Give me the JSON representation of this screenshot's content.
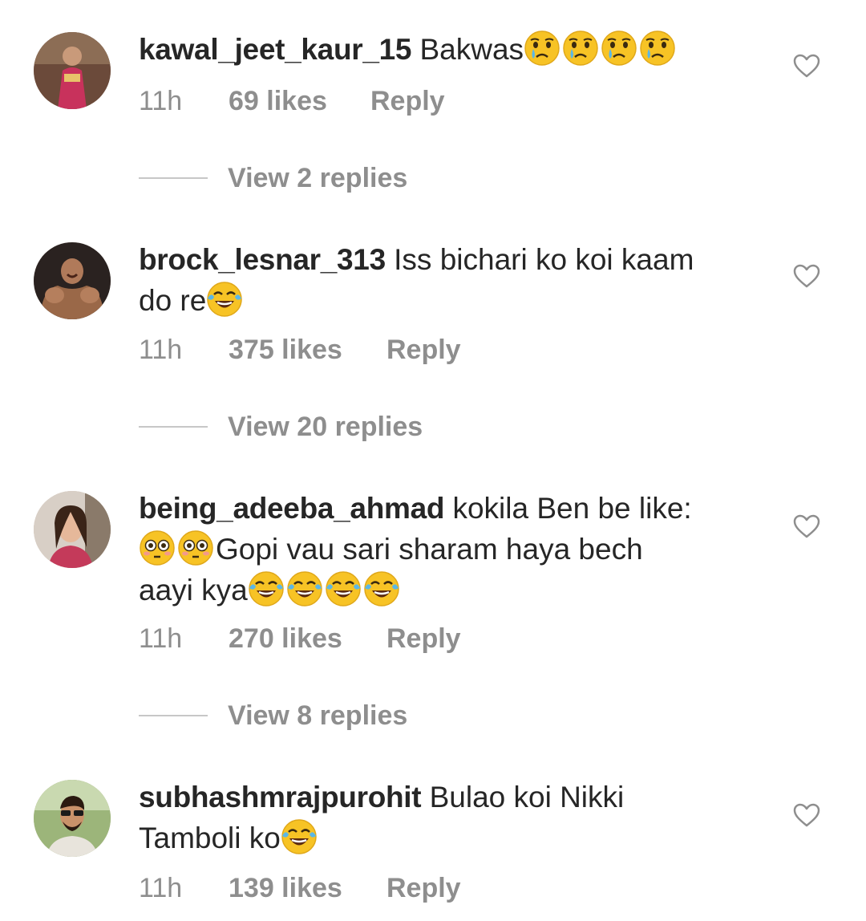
{
  "comments": [
    {
      "username": "kawal_jeet_kaur_15",
      "text_lines": [
        "Bakwas"
      ],
      "emoji_icons": [
        "crying-face",
        "crying-face",
        "crying-face",
        "crying-face"
      ],
      "time": "11h",
      "likes": "69 likes",
      "reply": "Reply",
      "view_replies": "View 2 replies",
      "avatar_icon": "user-avatar"
    },
    {
      "username": "brock_lesnar_313",
      "text_lines": [
        "Iss bichari ko koi kaam",
        "do re"
      ],
      "emoji_icons": [
        "face-with-tears-of-joy"
      ],
      "time": "11h",
      "likes": "375 likes",
      "reply": "Reply",
      "view_replies": "View 20 replies",
      "avatar_icon": "user-avatar"
    },
    {
      "username": "being_adeeba_ahmad",
      "text_lines": [
        "kokila Ben be like:",
        "Gopi vau sari sharam haya bech",
        "aayi kya"
      ],
      "emoji_icons": [
        "flushed-face",
        "flushed-face",
        "face-with-tears-of-joy",
        "face-with-tears-of-joy",
        "face-with-tears-of-joy",
        "face-with-tears-of-joy"
      ],
      "time": "11h",
      "likes": "270 likes",
      "reply": "Reply",
      "view_replies": "View 8 replies",
      "avatar_icon": "user-avatar"
    },
    {
      "username": "subhashmrajpurohit",
      "text_lines": [
        "Bulao koi Nikki",
        "Tamboli ko"
      ],
      "emoji_icons": [
        "face-with-tears-of-joy"
      ],
      "time": "11h",
      "likes": "139 likes",
      "reply": "Reply",
      "avatar_icon": "user-avatar"
    }
  ],
  "icons": {
    "like": "heart-outline-icon"
  },
  "colors": {
    "text": "#262626",
    "secondary": "#8e8e8e",
    "divider": "#c7c7c7",
    "emoji_yellow": "#f7c325"
  }
}
